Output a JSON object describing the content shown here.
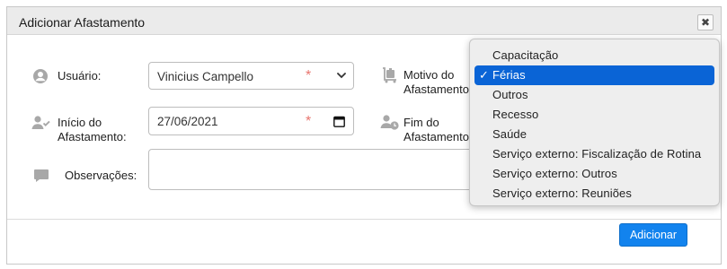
{
  "dialog": {
    "title": "Adicionar Afastamento",
    "close_glyph": "✖"
  },
  "form": {
    "usuario": {
      "label": "Usuário:",
      "value": "Vinicius Campello",
      "required": "*"
    },
    "motivo": {
      "label_line1": "Motivo do",
      "label_line2": "Afastamento:"
    },
    "inicio": {
      "label_line1": "Início do",
      "label_line2": "Afastamento:",
      "value": "27/06/2021",
      "required": "*"
    },
    "fim": {
      "label_line1": "Fim do",
      "label_line2": "Afastamento:"
    },
    "observacoes": {
      "label": "Observações:"
    }
  },
  "dropdown": {
    "check_glyph": "✓",
    "options": [
      "Capacitação",
      "Férias",
      "Outros",
      "Recesso",
      "Saúde",
      "Serviço externo: Fiscalização de Rotina",
      "Serviço externo: Outros",
      "Serviço externo: Reuniões"
    ],
    "selected_index": 1
  },
  "footer": {
    "submit_label": "Adicionar"
  },
  "colors": {
    "accent": "#1283ee",
    "required": "#e8756e",
    "selection": "#0a64d6"
  }
}
